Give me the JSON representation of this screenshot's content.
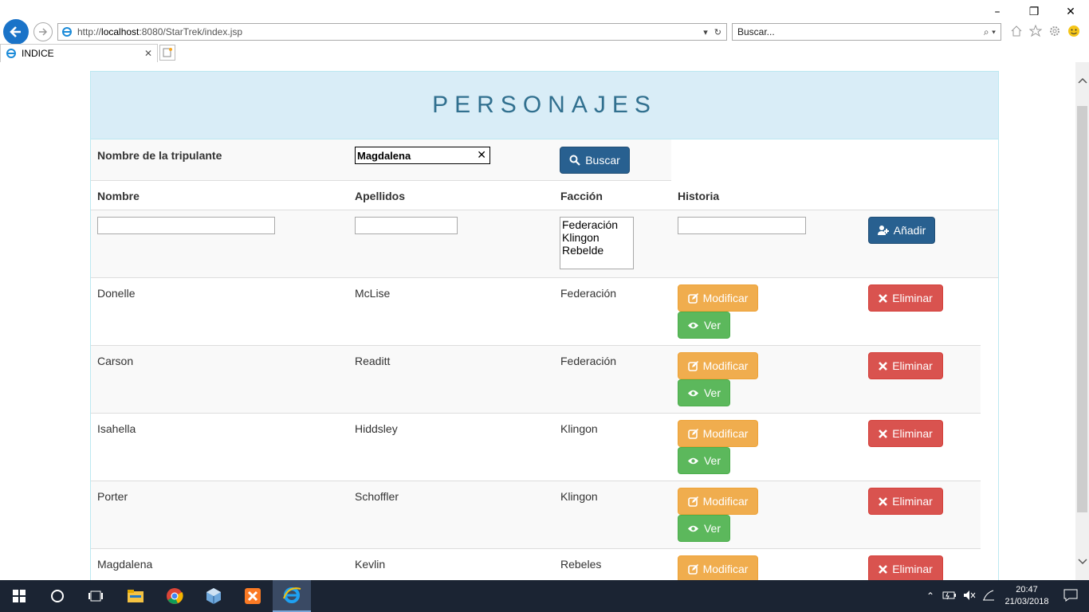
{
  "browser": {
    "url_prefix": "http://",
    "url_host": "localhost",
    "url_rest": ":8080/StarTrek/index.jsp",
    "search_placeholder": "Buscar...",
    "tab_title": "INDICE"
  },
  "page": {
    "heading": "PERSONAJES",
    "search_label": "Nombre de la tripulante",
    "search_value": "Magdalena",
    "search_button": "Buscar",
    "columns": [
      "Nombre",
      "Apellidos",
      "Facción",
      "Historia"
    ],
    "faction_options": [
      "Federación",
      "Klingon",
      "Rebelde"
    ],
    "add_button": "Añadir",
    "modify_label": "Modificar",
    "view_label": "Ver",
    "delete_label": "Eliminar",
    "rows": [
      {
        "nombre": "Donelle",
        "apellidos": "McLise",
        "faccion": "Federación"
      },
      {
        "nombre": "Carson",
        "apellidos": "Readitt",
        "faccion": "Federación"
      },
      {
        "nombre": "Isahella",
        "apellidos": "Hiddsley",
        "faccion": "Klingon"
      },
      {
        "nombre": "Porter",
        "apellidos": "Schoffler",
        "faccion": "Klingon"
      },
      {
        "nombre": "Magdalena",
        "apellidos": "Kevlin",
        "faccion": "Rebeles"
      }
    ]
  },
  "taskbar": {
    "time": "20:47",
    "date": "21/03/2018"
  },
  "colors": {
    "heading_bg": "#d9edf7",
    "heading_text": "#31708f",
    "primary": "#286090",
    "warning": "#f0ad4e",
    "success": "#5cb85c",
    "danger": "#d9534f"
  }
}
